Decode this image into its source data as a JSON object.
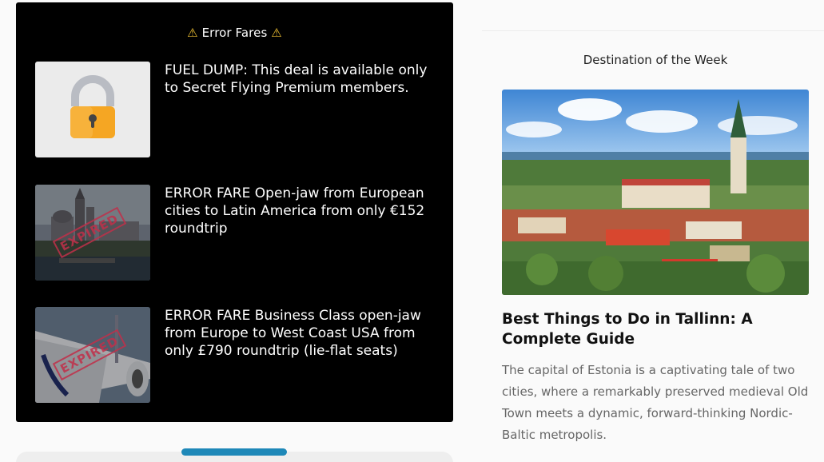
{
  "error_fares": {
    "title": "Error Fares",
    "deals": [
      {
        "text": "FUEL DUMP: This deal is available only to Secret Flying Premium members.",
        "thumb": "lock-icon"
      },
      {
        "text": "ERROR FARE Open-jaw from European cities to Latin America from only €152 roundtrip",
        "thumb": "expired-stamp",
        "stamp": "EXPIRED"
      },
      {
        "text": "ERROR FARE Business Class open-jaw from Europe to West Coast USA from only £790 roundtrip (lie-flat seats)",
        "thumb": "expired-stamp",
        "stamp": "EXPIRED"
      }
    ]
  },
  "destination": {
    "section_title": "Destination of the Week",
    "heading": "Best Things to Do in Tallinn: A Complete Guide",
    "description": "The capital of Estonia is a captivating tale of two cities, where a remarkably preserved medieval Old Town meets a dynamic, forward-thinking Nordic-Baltic metropolis."
  },
  "colors": {
    "panel_bg": "#000000",
    "accent_scroll": "#1e88b8",
    "warning": "#f1c232"
  }
}
